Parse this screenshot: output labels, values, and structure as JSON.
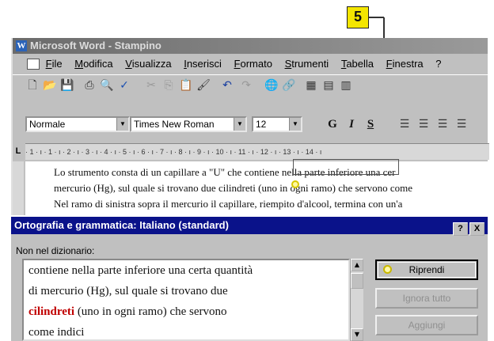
{
  "callout": {
    "label": "5"
  },
  "window": {
    "title": "Microsoft Word - Stampino",
    "app_letter": "W"
  },
  "menu": [
    "File",
    "Modifica",
    "Visualizza",
    "Inserisci",
    "Formato",
    "Strumenti",
    "Tabella",
    "Finestra",
    "?"
  ],
  "toolbar": {
    "style_value": "Normale",
    "font_value": "Times New Roman",
    "size_value": "12",
    "bold_label": "G",
    "italic_label": "I",
    "underline_label": "S"
  },
  "ruler": {
    "corner": "L",
    "marks": "· 1 · ı · 1 · ı · 2 · ı · 3 · ı · 4 · ı · 5 · ı · 6 · ı · 7 · ı · 8 · ı · 9 · ı · 10 · ı · 11 · ı · 12 · ı · 13 · ı · 14 · ı"
  },
  "document": {
    "line1": "Lo strumento consta di un capillare a \"U\" che contiene nella parte inferiore una cer",
    "line2": "mercurio (Hg), sul quale si trovano due cilindreti (uno in ogni ramo) che servono come",
    "line3": "Nel ramo di sinistra sopra il mercurio il capillare, riempito d'alcool, termina con un'a"
  },
  "dialog": {
    "title": "Ortografia e grammatica: Italiano (standard)",
    "help_btn": "?",
    "close_btn": "X",
    "not_in_dictionary_label": "Non nel dizionario:",
    "text_lines": [
      "contiene nella parte inferiore una certa quantità",
      "di mercurio (Hg), sul quale si trovano due"
    ],
    "error_word": "cilindreti",
    "line3_rest": " (uno in ogni ramo) che servono",
    "line4": "come indici",
    "buttons": {
      "resume": "Riprendi",
      "ignore_all": "Ignora tutto",
      "add": "Aggiungi"
    }
  }
}
